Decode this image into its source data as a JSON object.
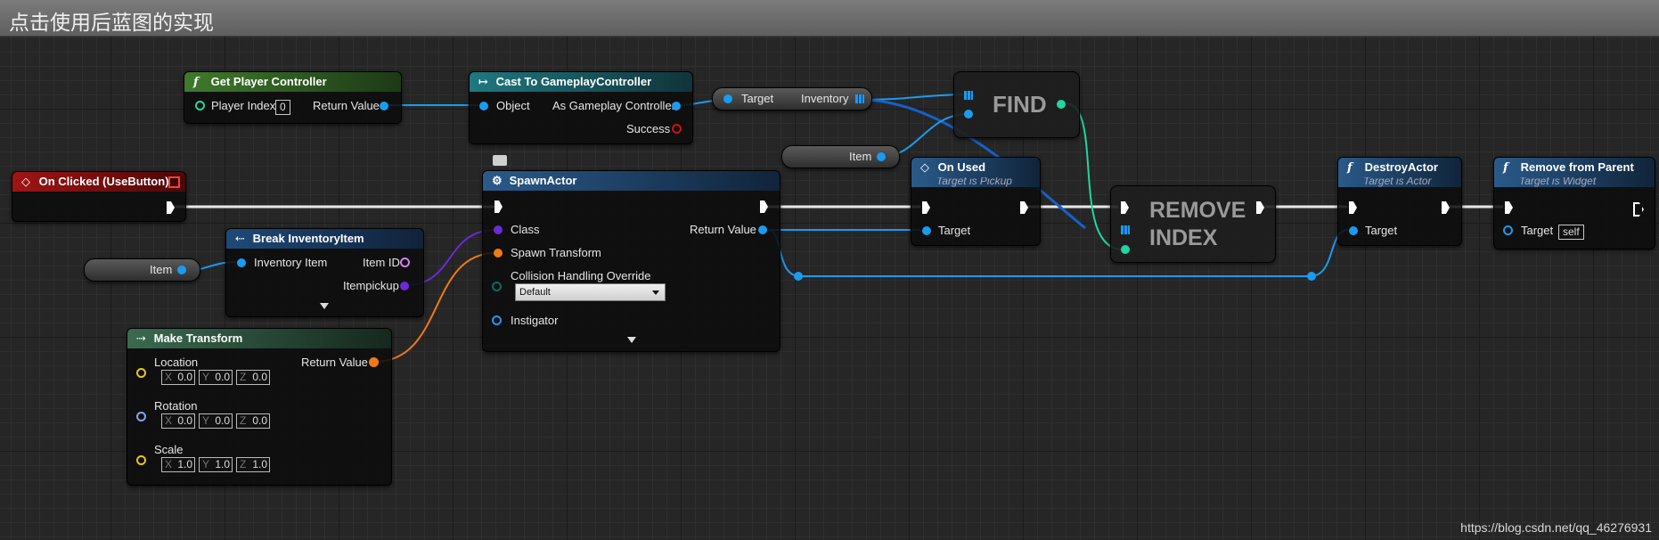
{
  "window": {
    "title": "点击使用后蓝图的实现"
  },
  "colors": {
    "exec_wire": "#ffffff",
    "object_pin": "#1a9bf0",
    "class_pin": "#6a2ad6",
    "struct_pin": "#f07a18",
    "vector_pin": "#f0c020",
    "rotator_pin": "#8aa0f0",
    "bool_pin": "#d01010",
    "int_pin": "#20d6a0",
    "event_header": "#8f1010",
    "pure_header": "#3a6a2a",
    "cast_header": "#1a6470",
    "function_header": "#2a5a8a"
  },
  "nodes": {
    "get_player_controller": {
      "title": "Get Player Controller",
      "icon": "function-icon",
      "player_index_label": "Player Index",
      "player_index_value": "0",
      "return_label": "Return Value"
    },
    "cast": {
      "title": "Cast To GameplayController",
      "icon": "cast-icon",
      "object_label": "Object",
      "as_label": "As Gameplay Controller",
      "success_label": "Success"
    },
    "target_inventory": {
      "target_label": "Target",
      "inventory_label": "Inventory"
    },
    "find": {
      "label": "FIND"
    },
    "item_var_1": {
      "label": "Item"
    },
    "on_clicked": {
      "title": "On Clicked (UseButton)",
      "icon": "event-icon"
    },
    "break_item": {
      "title": "Break InventoryItem",
      "icon": "break-struct-icon",
      "in_label": "Inventory Item",
      "item_id_label": "Item ID",
      "itempickup_label": "Itempickup"
    },
    "item_var_2": {
      "label": "Item"
    },
    "make_transform": {
      "title": "Make Transform",
      "icon": "make-struct-icon",
      "location_label": "Location",
      "rotation_label": "Rotation",
      "scale_label": "Scale",
      "return_label": "Return Value",
      "location": [
        "0.0",
        "0.0",
        "0.0"
      ],
      "rotation": [
        "0.0",
        "0.0",
        "0.0"
      ],
      "scale": [
        "1.0",
        "1.0",
        "1.0"
      ],
      "axes": [
        "X",
        "Y",
        "Z"
      ]
    },
    "spawn_actor": {
      "title": "SpawnActor",
      "icon": "spawn-icon",
      "class_label": "Class",
      "transform_label": "Spawn Transform",
      "collision_label": "Collision Handling Override",
      "collision_value": "Default",
      "instigator_label": "Instigator",
      "return_label": "Return Value"
    },
    "on_used": {
      "title": "On Used",
      "subtitle": "Target is Pickup",
      "icon": "event-icon",
      "target_label": "Target"
    },
    "remove_index": {
      "line1": "REMOVE",
      "line2": "INDEX"
    },
    "destroy_actor": {
      "title": "DestroyActor",
      "subtitle": "Target is Actor",
      "icon": "function-icon",
      "target_label": "Target"
    },
    "remove_parent": {
      "title": "Remove from Parent",
      "subtitle": "Target is Widget",
      "icon": "function-icon",
      "target_label": "Target",
      "target_value": "self"
    }
  },
  "watermark": "https://blog.csdn.net/qq_46276931"
}
